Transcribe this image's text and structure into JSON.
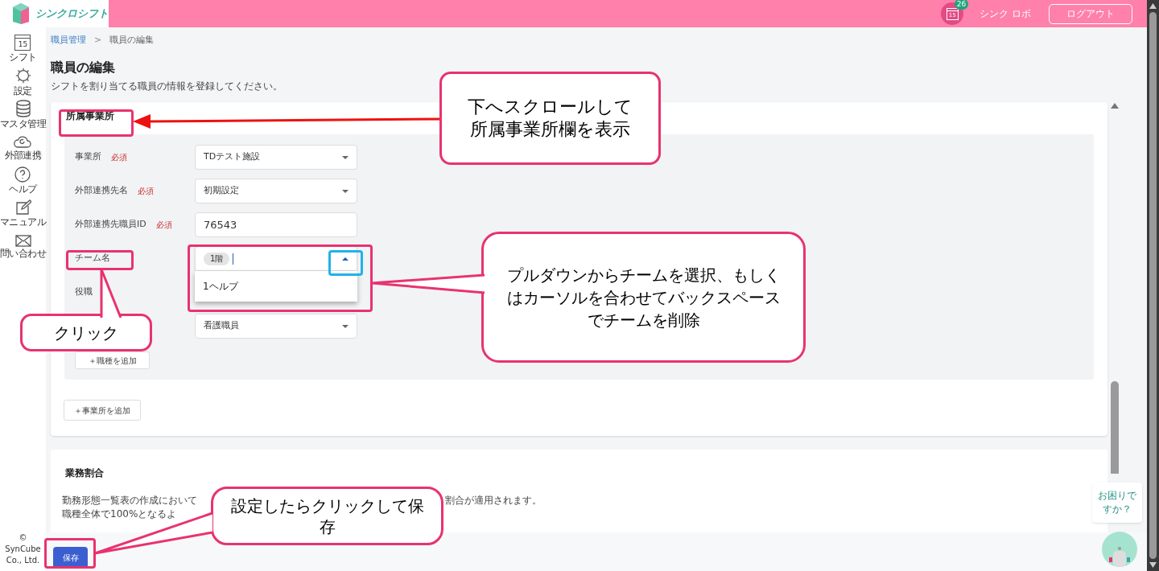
{
  "header": {
    "logo_text": "シンクロシフト",
    "notification": {
      "calendar_day": "15",
      "count": "26"
    },
    "user_name": "シンク ロボ",
    "logout": "ログアウト"
  },
  "sidebar": {
    "items": [
      {
        "kind": "calendar",
        "label": "シフト",
        "calendar_day": "15"
      },
      {
        "kind": "gear",
        "label": "設定"
      },
      {
        "kind": "database",
        "label": "マスタ管理"
      },
      {
        "kind": "cloud",
        "label": "外部連携"
      },
      {
        "kind": "help",
        "label": "ヘルプ"
      },
      {
        "kind": "edit",
        "label": "マニュアル"
      },
      {
        "kind": "mail",
        "label": "問い合わせ"
      }
    ],
    "copyright": "© SynCube Co., Ltd."
  },
  "breadcrumb": [
    {
      "label": "職員管理",
      "link": true
    },
    {
      "label": "職員の編集",
      "link": false
    }
  ],
  "breadcrumb_separator": ">",
  "page_title": "職員の編集",
  "page_description": "シフトを割り当てる職員の情報を登録してください。",
  "office_section": {
    "title": "所属事業所",
    "fields": [
      {
        "kind": "select",
        "label": "事業所",
        "required_badge": "必須",
        "value": "TDテスト施設"
      },
      {
        "kind": "select",
        "label": "外部連携先名",
        "required_badge": "必須",
        "value": "初期設定"
      },
      {
        "kind": "text",
        "label": "外部連携先職員ID",
        "required_badge": "必須",
        "value": "76543"
      },
      {
        "kind": "multiselect",
        "label": "チーム名",
        "chips": [
          "1階"
        ],
        "expanded": true,
        "options": [
          "1ヘルプ"
        ]
      },
      {
        "kind": "covered",
        "label": "役職"
      },
      {
        "kind": "select",
        "value": "看護職員"
      }
    ],
    "add_job_button": "＋職種を追加",
    "add_office_button": "＋事業所を追加"
  },
  "ratio_section": {
    "title": "業務割合",
    "lines": [
      {
        "left": "勤務形態一覧表の作成において",
        "right": "割合が適用されます。"
      },
      {
        "left": "職種全体で100%となるよ"
      }
    ]
  },
  "save_button": "保存",
  "help_bubble": "お困りですか？",
  "annotations": [
    {
      "kind": "callout",
      "lines": [
        "下へスクロールして",
        "所属事業所欄を表示"
      ]
    },
    {
      "kind": "callout",
      "lines": [
        "プルダウンからチームを選択、もしく",
        "はカーソルを合わせてバックスペース",
        "でチームを削除"
      ]
    },
    {
      "kind": "callout",
      "lines": [
        "クリック"
      ]
    },
    {
      "kind": "callout",
      "lines": [
        "設定したらクリックして保",
        "存"
      ]
    }
  ]
}
